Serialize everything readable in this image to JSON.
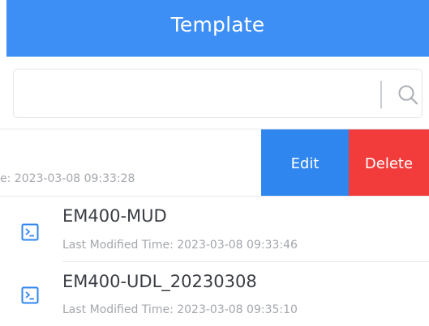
{
  "header": {
    "title": "Template"
  },
  "search": {
    "value": "",
    "placeholder": "",
    "icon": "search-icon"
  },
  "swiped_item": {
    "time_text": "e: 2023-03-08 09:33:28",
    "edit_label": "Edit",
    "delete_label": "Delete"
  },
  "items": [
    {
      "name": "EM400-MUD",
      "time_text": "Last Modified Time: 2023-03-08 09:33:46",
      "icon": "terminal-icon"
    },
    {
      "name": "EM400-UDL_20230308",
      "time_text": "Last Modified Time: 2023-03-08 09:35:10",
      "icon": "terminal-icon"
    }
  ],
  "colors": {
    "header_bg": "#3d8ef5",
    "edit_bg": "#2f86ef",
    "delete_bg": "#f23c3c",
    "icon": "#2f86ef"
  }
}
